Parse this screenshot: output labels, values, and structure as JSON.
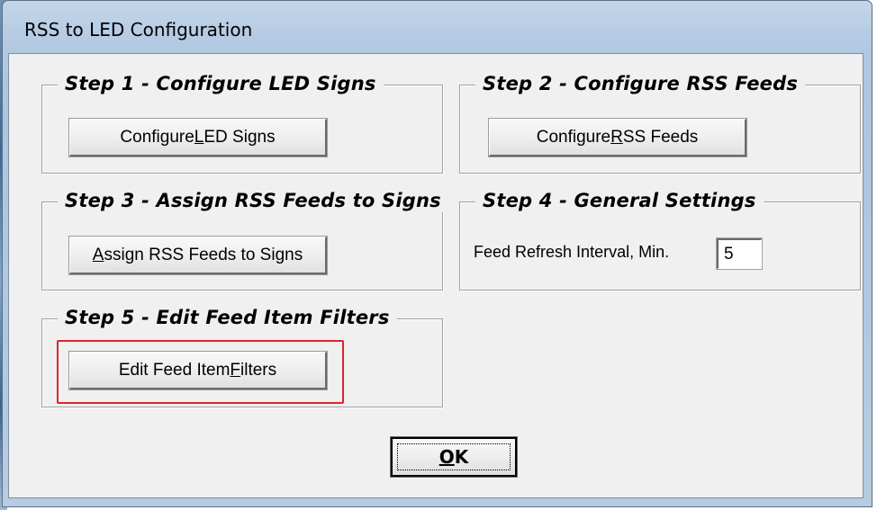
{
  "window": {
    "title": "RSS to LED Configuration"
  },
  "step1": {
    "title": "Step 1 - Configure LED Signs",
    "button": {
      "pre": "Configure ",
      "key": "L",
      "post": "ED Signs"
    }
  },
  "step2": {
    "title": "Step 2 - Configure RSS Feeds",
    "button": {
      "pre": "Configure ",
      "key": "R",
      "post": "SS Feeds"
    }
  },
  "step3": {
    "title": "Step 3 - Assign RSS Feeds to Signs",
    "button": {
      "pre": "",
      "key": "A",
      "post": "ssign RSS Feeds to Signs"
    }
  },
  "step4": {
    "title": "Step 4 - General Settings",
    "refresh_label": "Feed Refresh Interval, Min.",
    "refresh_value": "5"
  },
  "step5": {
    "title": "Step 5 - Edit Feed Item Filters",
    "button": {
      "pre": "Edit Feed Item ",
      "key": "F",
      "post": "ilters"
    },
    "highlight_color": "#e0242c"
  },
  "ok_button": {
    "key": "O",
    "post": "K"
  }
}
